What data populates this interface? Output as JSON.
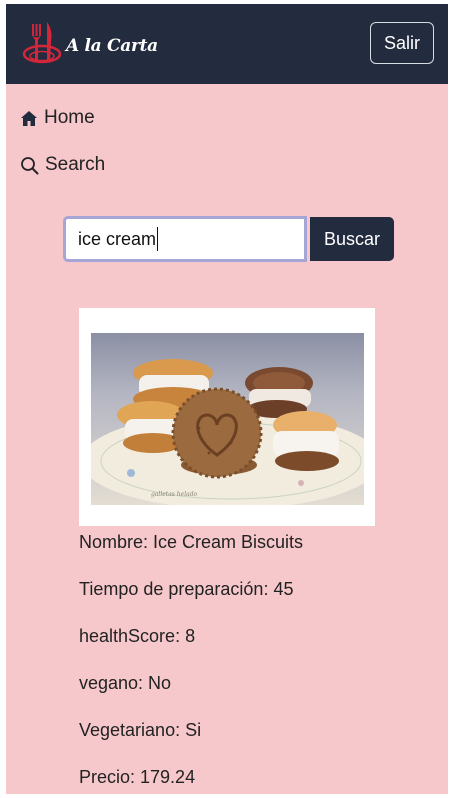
{
  "navbar": {
    "brand_text": "A la Carta",
    "logout_label": "Salir"
  },
  "nav": {
    "home_label": "Home",
    "search_label": "Search"
  },
  "search": {
    "value": "ice cream",
    "button_label": "Buscar"
  },
  "recipe": {
    "image_watermark": "galletas helado",
    "name_text": "Nombre: Ice Cream Biscuits",
    "prep_time_text": "Tiempo de preparación: 45",
    "health_score_text": "healthScore: 8",
    "vegan_text": "vegano: No",
    "vegetarian_text": "Vegetariano: Si",
    "price_text": "Precio: 179.24"
  },
  "colors": {
    "navbar": "#232b3e",
    "background": "#f6c8cb",
    "logo_red": "#d4263a"
  }
}
